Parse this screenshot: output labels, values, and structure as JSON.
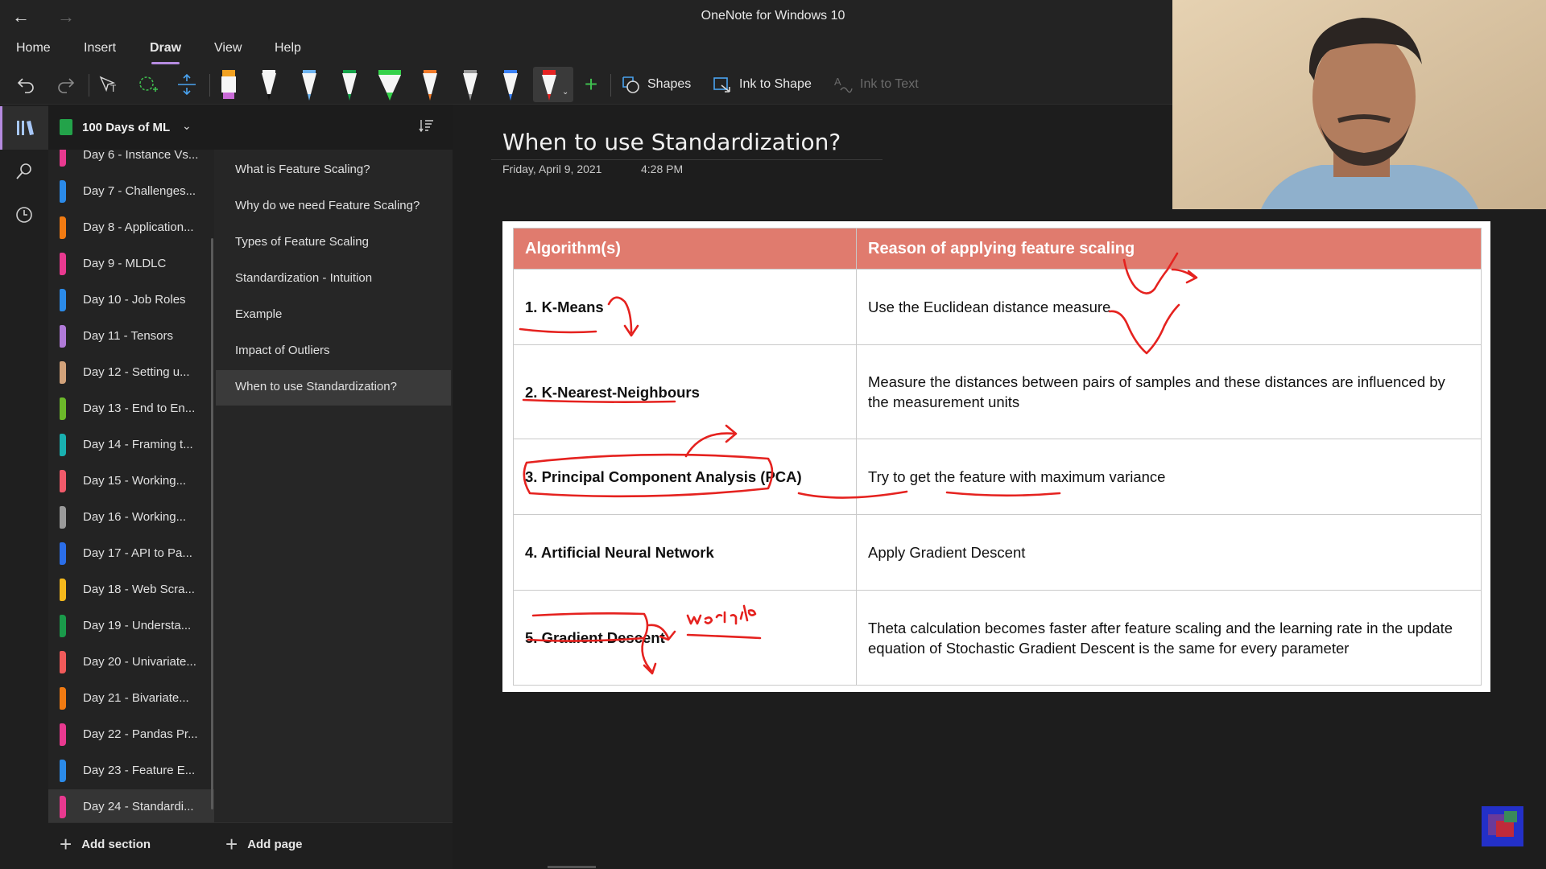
{
  "window": {
    "title": "OneNote for Windows 10"
  },
  "menu": {
    "items": [
      "Home",
      "Insert",
      "Draw",
      "View",
      "Help"
    ],
    "active": "Draw"
  },
  "ribbon": {
    "shapes_label": "Shapes",
    "ink_to_shape_label": "Ink to Shape",
    "ink_to_text_label": "Ink to Text",
    "pens": [
      {
        "name": "highlighter-pen",
        "color": "#c86ad6"
      },
      {
        "name": "black-pen",
        "color": "#111111"
      },
      {
        "name": "light-blue-pen",
        "color": "#6fb4f0"
      },
      {
        "name": "green-pen",
        "color": "#16a34a"
      },
      {
        "name": "green-highlighter",
        "color": "#35d14a"
      },
      {
        "name": "orange-pen",
        "color": "#f07a2a"
      },
      {
        "name": "galaxy-pen",
        "color": "#9a9a9a"
      },
      {
        "name": "blue-pen",
        "color": "#3b82f6"
      },
      {
        "name": "red-pen",
        "color": "#e52222"
      }
    ]
  },
  "notebook": {
    "name": "100 Days of ML"
  },
  "sections": [
    {
      "label": "Day 6 - Instance Vs...",
      "color": "#e8398f"
    },
    {
      "label": "Day 7 - Challenges...",
      "color": "#2b8ae8"
    },
    {
      "label": "Day 8 - Application...",
      "color": "#f07a12"
    },
    {
      "label": "Day 9 - MLDLC",
      "color": "#e8398f"
    },
    {
      "label": "Day 10 - Job Roles",
      "color": "#2b8ae8"
    },
    {
      "label": "Day 11 - Tensors",
      "color": "#b07ad8"
    },
    {
      "label": "Day 12 - Setting u...",
      "color": "#d2a27a"
    },
    {
      "label": "Day 13 - End to En...",
      "color": "#6cb82a"
    },
    {
      "label": "Day 14 - Framing t...",
      "color": "#19b0b0"
    },
    {
      "label": "Day 15 - Working...",
      "color": "#f05a6a"
    },
    {
      "label": "Day 16 - Working...",
      "color": "#9a9a9a"
    },
    {
      "label": "Day 17 - API to Pa...",
      "color": "#2b6ee8"
    },
    {
      "label": "Day 18 - Web Scra...",
      "color": "#f4b81c"
    },
    {
      "label": "Day 19 - Understa...",
      "color": "#1a9a4a"
    },
    {
      "label": "Day 20 - Univariate...",
      "color": "#f05a5a"
    },
    {
      "label": "Day 21 - Bivariate...",
      "color": "#f07a12"
    },
    {
      "label": "Day 22 - Pandas Pr...",
      "color": "#e8398f"
    },
    {
      "label": "Day 23 - Feature E...",
      "color": "#2b8ae8"
    },
    {
      "label": "Day 24 - Standardi...",
      "color": "#e8398f"
    }
  ],
  "pages": [
    "What is Feature Scaling?",
    "Why do we need Feature Scaling?",
    "Types of Feature Scaling",
    "Standardization - Intuition",
    "Example",
    "Impact of Outliers",
    "When to use Standardization?"
  ],
  "footer": {
    "add_section": "Add section",
    "add_page": "Add page"
  },
  "page": {
    "title": "When to use Standardization?",
    "date": "Friday, April 9, 2021",
    "time": "4:28 PM"
  },
  "table": {
    "headers": [
      "Algorithm(s)",
      "Reason of applying feature scaling"
    ],
    "rows": [
      {
        "algorithm": "1. K-Means",
        "reason": "Use the Euclidean distance measure."
      },
      {
        "algorithm": "2. K-Nearest-Neighbours",
        "reason": "Measure the distances between pairs of samples and these distances are influenced by the measurement units"
      },
      {
        "algorithm": "3. Principal Component Analysis (PCA)",
        "reason": "Try to get the feature with maximum variance"
      },
      {
        "algorithm": "4. Artificial Neural Network",
        "reason": "Apply Gradient Descent"
      },
      {
        "algorithm": "5. Gradient Descent",
        "reason": "Theta calculation becomes faster after feature scaling and the learning rate in the update equation of Stochastic Gradient Descent is the same for every parameter"
      }
    ],
    "header_color": "#e07b6e"
  },
  "ink": {
    "handwritten_note": "weights",
    "color": "#e5221f"
  }
}
